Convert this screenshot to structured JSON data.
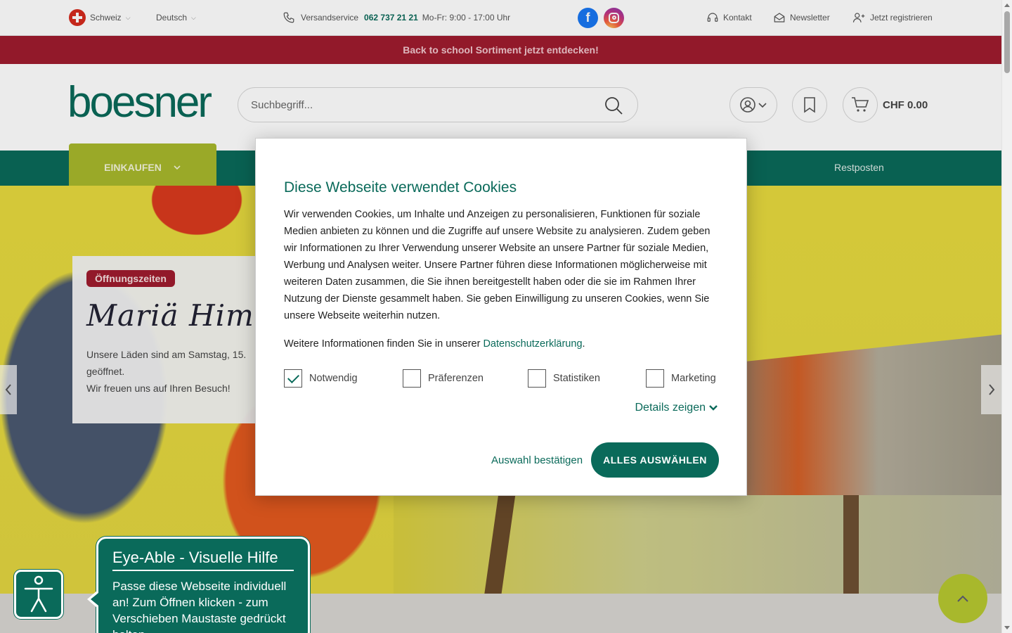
{
  "topbar": {
    "country": "Schweiz",
    "language": "Deutsch",
    "service_label": "Versandservice",
    "phone": "062 737 21 21",
    "hours": "Mo-Fr: 9:00 - 17:00 Uhr",
    "contact": "Kontakt",
    "newsletter": "Newsletter",
    "register": "Jetzt registrieren"
  },
  "promo": {
    "text": "Back to school Sortiment jetzt entdecken!"
  },
  "header": {
    "logo": "boesner",
    "search_placeholder": "Suchbegriff...",
    "cart_total": "CHF 0.00"
  },
  "nav": {
    "shop": "EINKAUFEN",
    "restposten": "Restposten"
  },
  "hero": {
    "badge": "Öffnungszeiten",
    "title": "Mariä Himmelfahrt",
    "text_line1": "Unsere Läden sind am Samstag, 15.",
    "text_line2": "geöffnet.",
    "text_line3": "Wir freuen uns auf Ihren Besuch!"
  },
  "cookie": {
    "title": "Diese Webseite verwendet Cookies",
    "body": "Wir verwenden Cookies, um Inhalte und Anzeigen zu personalisieren, Funktionen für soziale Medien anbieten zu können und die Zugriffe auf unsere Website zu analysieren. Zudem geben wir Informationen zu Ihrer Verwendung unserer Website an unsere Partner für soziale Medien, Werbung und Analysen weiter. Unsere Partner führen diese Informationen möglicherweise mit weiteren Daten zusammen, die Sie ihnen bereitgestellt haben oder die sie im Rahmen Ihrer Nutzung der Dienste gesammelt haben. Sie geben Einwilligung zu unseren Cookies, wenn Sie unsere Webseite weiterhin nutzen.",
    "more_prefix": "Weitere Informationen finden Sie in unserer ",
    "more_link": "Datenschutzerklärung",
    "more_suffix": ".",
    "options": [
      {
        "label": "Notwendig",
        "checked": true
      },
      {
        "label": "Präferenzen",
        "checked": false
      },
      {
        "label": "Statistiken",
        "checked": false
      },
      {
        "label": "Marketing",
        "checked": false
      }
    ],
    "details": "Details zeigen",
    "confirm": "Auswahl bestätigen",
    "select_all": "ALLES AUSWÄHLEN"
  },
  "eyeable": {
    "title": "Eye-Able - Visuelle Hilfe",
    "text": "Passe diese Webseite individuell an! Zum Öffnen klicken - zum Verschieben Maustaste gedrückt halten"
  },
  "colors": {
    "brand_green": "#0a6a5a",
    "accent_lime": "#a8b82c",
    "promo_red": "#9f1c2e"
  },
  "icons": [
    "swiss-flag-icon",
    "phone-icon",
    "facebook-icon",
    "instagram-icon",
    "headset-icon",
    "envelope-icon",
    "user-plus-icon",
    "search-icon",
    "user-icon",
    "bookmark-icon",
    "cart-icon",
    "chevron-down-icon",
    "chevron-left-icon",
    "chevron-right-icon",
    "accessibility-icon",
    "chevron-up-icon"
  ]
}
